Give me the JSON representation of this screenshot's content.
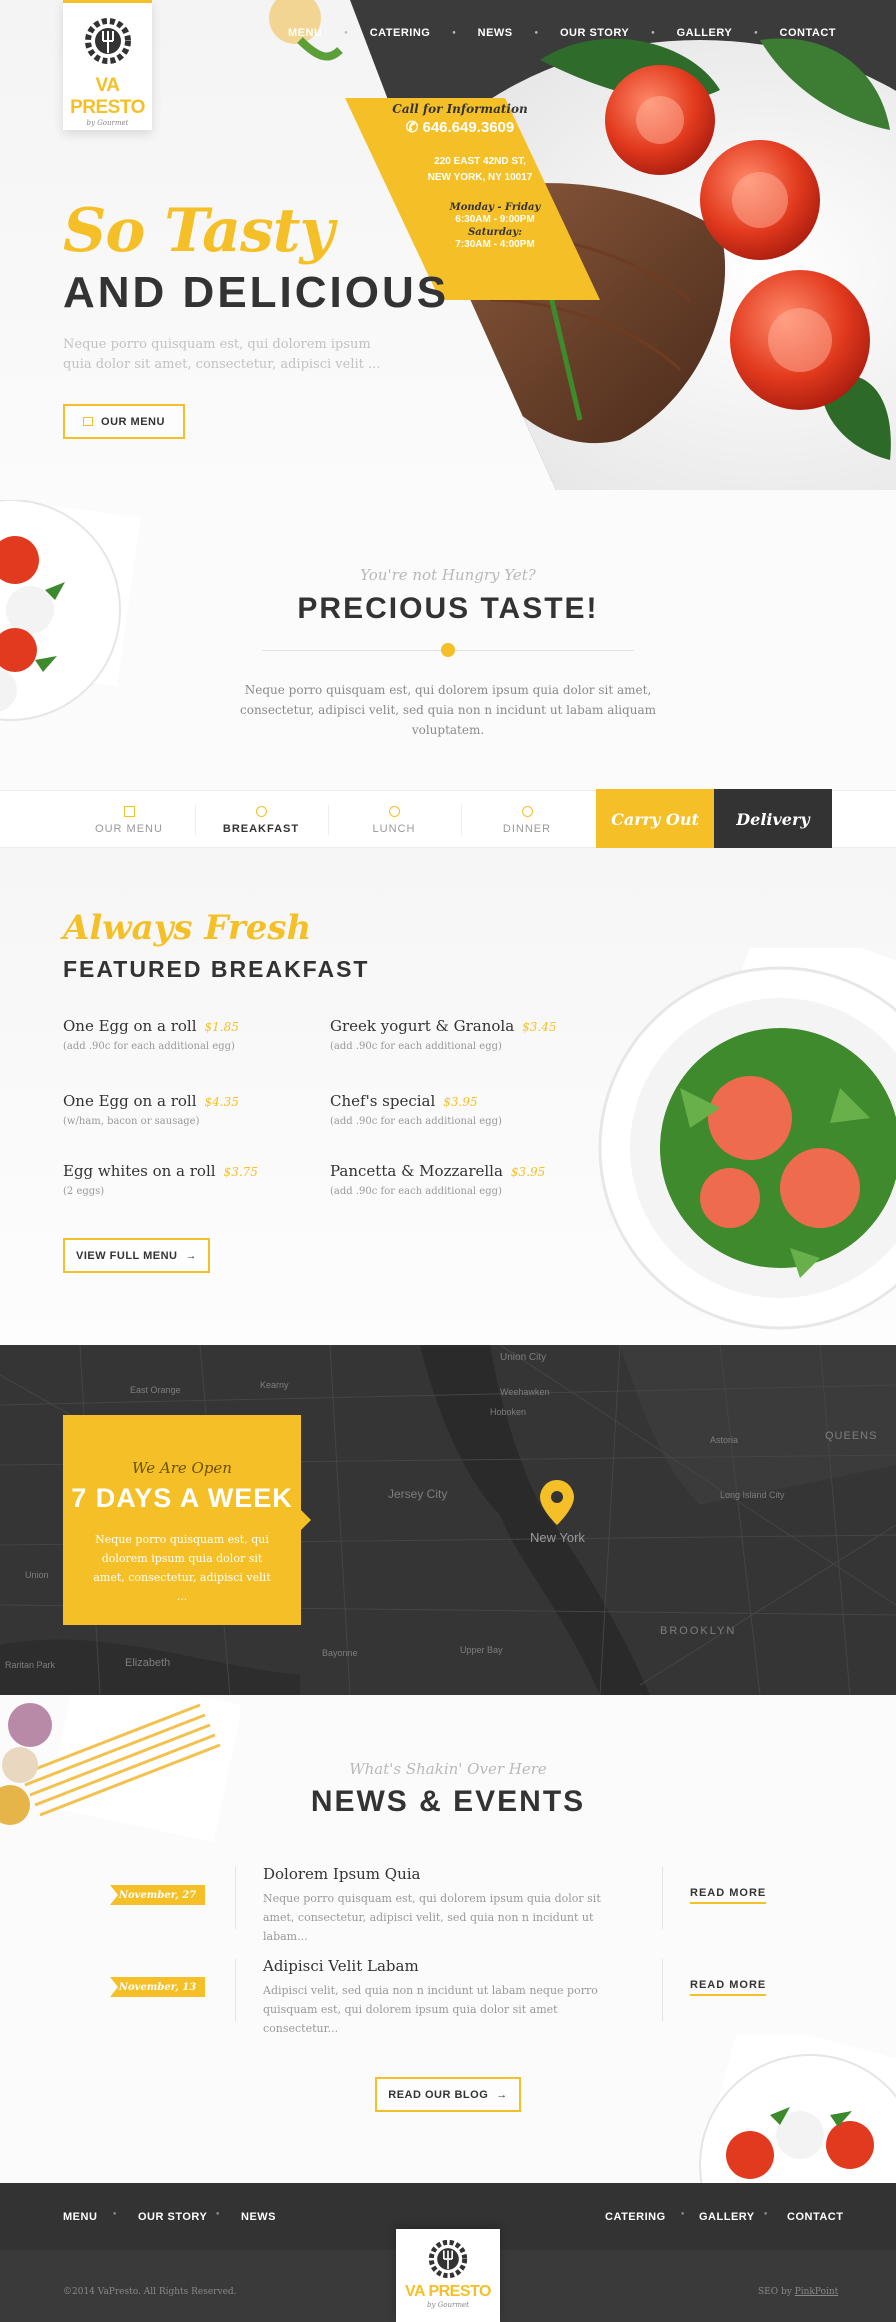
{
  "brand": {
    "name": "VA PRESTO",
    "tagline": "by Gourmet"
  },
  "nav": {
    "items": [
      "MENU",
      "CATERING",
      "NEWS",
      "OUR STORY",
      "GALLERY",
      "CONTACT"
    ]
  },
  "hero": {
    "script": "So Tasty",
    "title": "AND DELICIOUS",
    "text": "Neque porro quisquam est, qui dolorem ipsum quia dolor sit amet, consectetur, adipisci velit ...",
    "button": "OUR MENU"
  },
  "info": {
    "call_label": "Call for Information",
    "phone": "646.649.3609",
    "address_line1": "220 EAST 42ND ST,",
    "address_line2": "NEW YORK, NY 10017",
    "days1": "Monday - Friday",
    "hours1": "6:30AM - 9:00PM",
    "days2": "Saturday:",
    "hours2": "7:30AM - 4:00PM"
  },
  "taste": {
    "script": "You're not Hungry Yet?",
    "title": "PRECIOUS TASTE!",
    "text": "Neque porro quisquam est, qui dolorem ipsum quia dolor sit amet, consectetur, adipisci velit, sed quia non n incidunt ut labam aliquam voluptatem."
  },
  "tabs": {
    "items": [
      "OUR MENU",
      "BREAKFAST",
      "LUNCH",
      "DINNER"
    ],
    "active": "BREAKFAST",
    "carry_out": "Carry Out",
    "delivery": "Delivery"
  },
  "featured": {
    "script": "Always Fresh",
    "title": "FEATURED BREAKFAST",
    "items": [
      {
        "name": "One Egg on a roll",
        "price": "$1.85",
        "note": "(add .90c for each additional egg)"
      },
      {
        "name": "Greek yogurt & Granola",
        "price": "$3.45",
        "note": "(add .90c for each additional egg)"
      },
      {
        "name": "One Egg on a roll",
        "price": "$4.35",
        "note": "(w/ham, bacon or sausage)"
      },
      {
        "name": "Chef's special",
        "price": "$3.95",
        "note": "(add .90c for each additional egg)"
      },
      {
        "name": "Egg whites on a roll",
        "price": "$3.75",
        "note": "(2 eggs)"
      },
      {
        "name": "Pancetta & Mozzarella",
        "price": "$3.95",
        "note": "(add .90c for each additional egg)"
      }
    ],
    "button": "VIEW FULL MENU"
  },
  "open": {
    "script": "We Are Open",
    "title": "7 DAYS A WEEK",
    "text": "Neque porro quisquam est, qui dolorem ipsum quia dolor sit amet, consectetur, adipisci velit ..."
  },
  "map": {
    "pin_label": "New York",
    "labels": [
      "Union City",
      "East Orange",
      "Kearny",
      "Weehawken",
      "Hoboken",
      "Jersey City",
      "Union",
      "Elizabeth",
      "Bayonne",
      "Raritan Park",
      "QUEENS",
      "BROOKLYN",
      "Long Island City",
      "Astoria",
      "Upper Bay"
    ]
  },
  "news": {
    "script": "What's Shakin' Over Here",
    "title": "NEWS & EVENTS",
    "items": [
      {
        "date": "November, 27",
        "title": "Dolorem Ipsum Quia",
        "text": "Neque porro quisquam est, qui dolorem ipsum quia dolor sit amet, consectetur, adipisci velit, sed quia non n incidunt ut labam...",
        "link": "READ MORE"
      },
      {
        "date": "November, 13",
        "title": "Adipisci Velit Labam",
        "text": "Adipisci velit, sed quia non n incidunt ut labam neque porro quisquam est, qui dolorem ipsum quia dolor sit amet consectetur...",
        "link": "READ MORE"
      }
    ],
    "button": "READ OUR BLOG"
  },
  "footer": {
    "left_nav": [
      "MENU",
      "OUR STORY",
      "NEWS"
    ],
    "right_nav": [
      "CATERING",
      "GALLERY",
      "CONTACT"
    ],
    "copyright": "©2014 VaPresto. All Rights Reserved.",
    "credit_prefix": "SEO by",
    "credit_link": "PinkPoint"
  },
  "colors": {
    "accent": "#f5c027",
    "dark": "#333333"
  }
}
